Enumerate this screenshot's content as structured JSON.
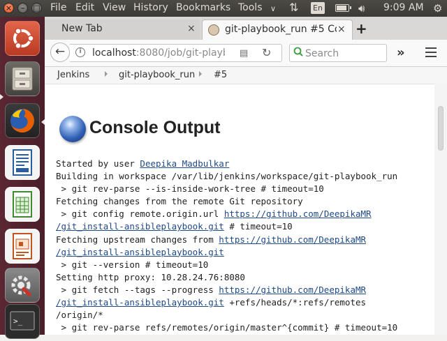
{
  "top_panel": {
    "menus": [
      "File",
      "Edit",
      "View",
      "History",
      "Bookmarks",
      "Tools"
    ],
    "language": "En",
    "clock": "9:09 AM",
    "icons": [
      "window-close-icon",
      "window-minimize-icon",
      "window-maximize-icon",
      "network-arrows-icon",
      "keyboard-language-icon",
      "battery-icon",
      "volume-icon",
      "power-gear-icon"
    ]
  },
  "launcher": {
    "items": [
      "ubuntu-dash-icon",
      "files-icon",
      "firefox-icon",
      "libreoffice-writer-icon",
      "libreoffice-calc-icon",
      "libreoffice-impress-icon",
      "system-settings-icon",
      "terminal-icon"
    ]
  },
  "tabs": [
    {
      "label": "New Tab",
      "close": "×"
    },
    {
      "label": "git-playbook_run #5 Co",
      "close": "×"
    }
  ],
  "new_tab_button": "+",
  "navbar": {
    "url_host": "localhost",
    "url_rest": ":8080/job/git-playb",
    "search_placeholder": "Search",
    "overflow": "»"
  },
  "breadcrumb": [
    "Jenkins",
    "git-playbook_run",
    "#5"
  ],
  "page": {
    "title": "Console Output"
  },
  "console": {
    "started_by_prefix": "Started by user ",
    "started_by_user": "Deepika Madbulkar",
    "line_workspace": "Building in workspace /var/lib/jenkins/workspace/git-playbook_run",
    "line_revparse": " > git rev-parse --is-inside-work-tree # timeout=10",
    "line_fetch_remote": "Fetching changes from the remote Git repository",
    "line_config_prefix": " > git config remote.origin.url ",
    "repo_url_part1": "https://github.com/DeepikaMR",
    "repo_url_part2": "/git_install-ansibleplaybook.git",
    "line_config_suffix": " # timeout=10",
    "line_fetch_upstream_prefix": "Fetching upstream changes from ",
    "line_version": " > git --version # timeout=10",
    "line_proxy": "Setting http proxy: 10.28.24.76:8080",
    "line_fetch_tags_prefix": " > git fetch --tags --progress ",
    "line_refspec_suffix": " +refs/heads/*:refs/remotes",
    "line_origin": "/origin/*",
    "line_revparse_master": " > git rev-parse refs/remotes/origin/master^{commit} # timeout=10"
  }
}
